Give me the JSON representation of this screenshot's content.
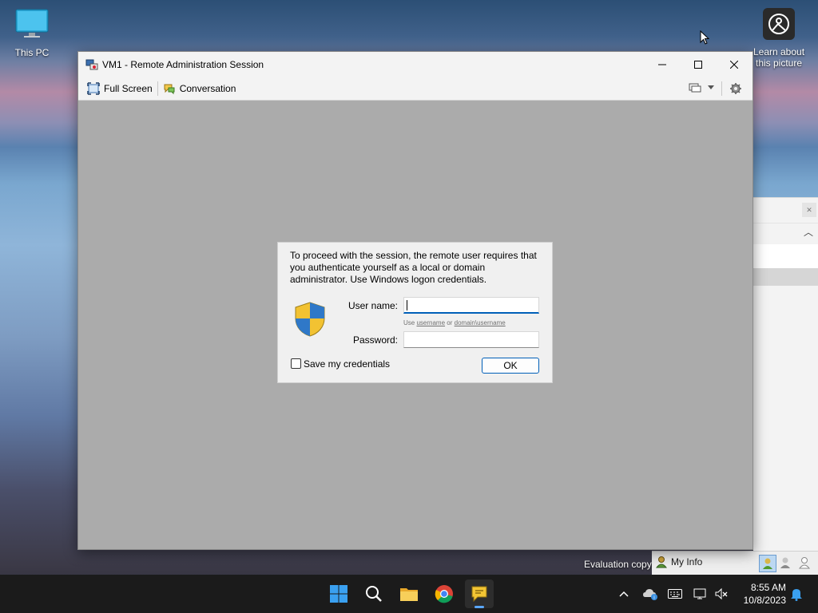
{
  "desktop": {
    "this_pc_label": "This PC",
    "learn_label_line1": "Learn about",
    "learn_label_line2": "this picture",
    "evaluation_text": "Evaluation copy",
    "my_info_label": "My Info"
  },
  "window": {
    "title": "VM1 - Remote Administration Session",
    "toolbar": {
      "full_screen_label": "Full Screen",
      "conversation_label": "Conversation"
    }
  },
  "dialog": {
    "message": "To proceed with the session, the remote user requires that you authenticate yourself as a local or domain administrator. Use Windows logon credentials.",
    "username_label": "User name:",
    "username_value": "",
    "hint_use": "Use",
    "hint_username": "username",
    "hint_or": "or",
    "hint_domain_username": "domain\\username",
    "password_label": "Password:",
    "password_value": "",
    "save_credentials_label": "Save my credentials",
    "save_credentials_checked": false,
    "ok_label": "OK"
  },
  "taskbar": {
    "time": "8:55 AM",
    "date": "10/8/2023",
    "apps": [
      "start-icon",
      "search-icon",
      "file-explorer-icon",
      "chrome-icon",
      "chat-bubble-icon"
    ]
  },
  "colors": {
    "accent": "#005fb8",
    "taskbar": "#1b1b1b",
    "session_background": "#ababab"
  }
}
